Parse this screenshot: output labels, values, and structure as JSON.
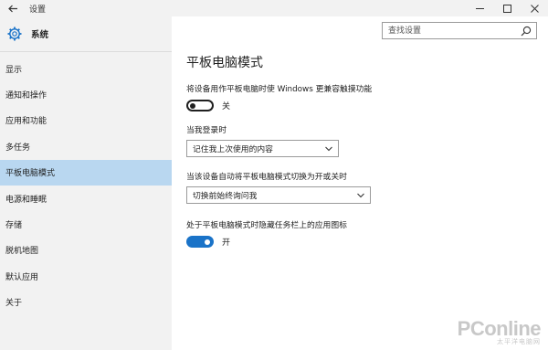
{
  "titlebar": {
    "back_icon": "arrow-left-icon",
    "title": "设置",
    "controls": [
      "minimize-icon",
      "maximize-icon",
      "close-icon"
    ]
  },
  "sidebar": {
    "header_icon": "gear-icon",
    "header_title": "系统",
    "items": [
      {
        "label": "显示",
        "active": false
      },
      {
        "label": "通知和操作",
        "active": false
      },
      {
        "label": "应用和功能",
        "active": false
      },
      {
        "label": "多任务",
        "active": false
      },
      {
        "label": "平板电脑模式",
        "active": true
      },
      {
        "label": "电源和睡眠",
        "active": false
      },
      {
        "label": "存储",
        "active": false
      },
      {
        "label": "脱机地图",
        "active": false
      },
      {
        "label": "默认应用",
        "active": false
      },
      {
        "label": "关于",
        "active": false
      }
    ]
  },
  "search": {
    "placeholder": "查找设置",
    "icon": "search-icon"
  },
  "main": {
    "title": "平板电脑模式",
    "touch_label": "将设备用作平板电脑时使 Windows 更兼容触摸功能",
    "touch_toggle_state": "关",
    "signin_label": "当我登录时",
    "signin_value": "记住我上次使用的内容",
    "autoswitch_label": "当该设备自动将平板电脑模式切换为开或关时",
    "autoswitch_value": "切换前始终询问我",
    "hide_icons_label": "处于平板电脑模式时隐藏任务栏上的应用图标",
    "hide_icons_toggle_state": "开"
  },
  "watermark": {
    "text": "PConline",
    "sub": "太平洋电脑网"
  },
  "colors": {
    "accent": "#1a73c8",
    "sidebar_bg": "#f2f2f2",
    "active_item": "#b9d7f0"
  }
}
